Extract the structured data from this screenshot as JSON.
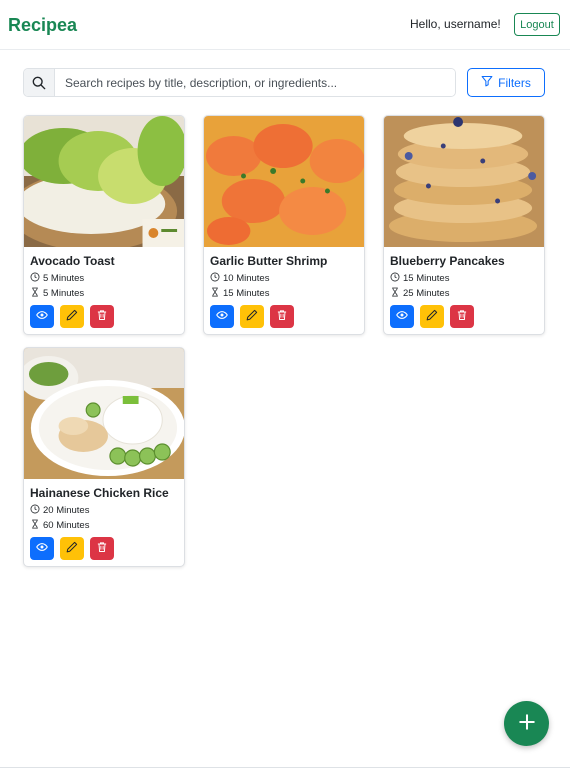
{
  "app": {
    "brand": "Recipea",
    "greeting": "Hello, username!",
    "logout_label": "Logout"
  },
  "search": {
    "placeholder": "Search recipes by title, description, or ingredients...",
    "value": ""
  },
  "filters": {
    "label": "Filters"
  },
  "colors": {
    "brand": "#198754",
    "view": "#0d6efd",
    "edit": "#ffc107",
    "delete": "#dc3545"
  },
  "icons": {
    "search": "search-icon",
    "filter": "filter-icon",
    "prep": "clock-icon",
    "cook": "hourglass-icon",
    "view": "eye-icon",
    "edit": "pencil-icon",
    "delete": "trash-icon",
    "add": "plus-icon"
  },
  "recipes": [
    {
      "title": "Avocado Toast",
      "prep": "5 Minutes",
      "cook": "5 Minutes"
    },
    {
      "title": "Garlic Butter Shrimp",
      "prep": "10 Minutes",
      "cook": "15 Minutes"
    },
    {
      "title": "Blueberry Pancakes",
      "prep": "15 Minutes",
      "cook": "25 Minutes"
    },
    {
      "title": "Hainanese Chicken Rice",
      "prep": "20 Minutes",
      "cook": "60 Minutes"
    }
  ]
}
